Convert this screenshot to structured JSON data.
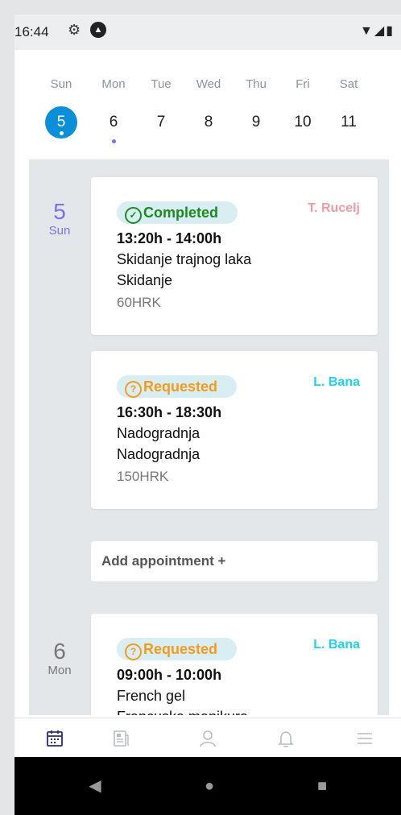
{
  "status_bar": {
    "time": "16:44",
    "right_icons": "▼◢▮"
  },
  "week": {
    "days": [
      {
        "name": "Sun",
        "num": "5",
        "selected": true,
        "dot": true
      },
      {
        "name": "Mon",
        "num": "6",
        "selected": false,
        "dot": true
      },
      {
        "name": "Tue",
        "num": "7",
        "selected": false,
        "dot": false
      },
      {
        "name": "Wed",
        "num": "8",
        "selected": false,
        "dot": false
      },
      {
        "name": "Thu",
        "num": "9",
        "selected": false,
        "dot": false
      },
      {
        "name": "Fri",
        "num": "10",
        "selected": false,
        "dot": false
      },
      {
        "name": "Sat",
        "num": "11",
        "selected": false,
        "dot": false
      }
    ]
  },
  "schedule": {
    "day1": {
      "num": "5",
      "day": "Sun"
    },
    "day2": {
      "num": "6",
      "day": "Mon"
    },
    "appointments": [
      {
        "status": "Completed",
        "icon": "✓",
        "staff": "T. Rucelj",
        "time": "13:20h - 14:00h",
        "service": "Skidanje trajnog laka",
        "sub": "Skidanje",
        "price": "60HRK"
      },
      {
        "status": "Requested",
        "icon": "?",
        "staff": "L. Bana",
        "time": "16:30h - 18:30h",
        "service": "Nadogradnja",
        "sub": "Nadogradnja",
        "price": "150HRK"
      },
      {
        "status": "Requested",
        "icon": "?",
        "staff": "L. Bana",
        "time": "09:00h - 10:00h",
        "service": "French gel",
        "sub": "Francuska manikura",
        "price": ""
      }
    ],
    "add_label": "Add appointment +"
  },
  "bottom_nav": {
    "items": [
      {
        "icon": "calendar-icon",
        "glyph": "📅"
      },
      {
        "icon": "news-icon",
        "glyph": "▤"
      },
      {
        "icon": "person-icon",
        "glyph": "⚇"
      },
      {
        "icon": "bell-icon",
        "glyph": "🔔"
      },
      {
        "icon": "menu-icon",
        "glyph": "☰"
      }
    ]
  },
  "system_nav": {
    "back": "◀",
    "home": "●",
    "recent": "■"
  }
}
